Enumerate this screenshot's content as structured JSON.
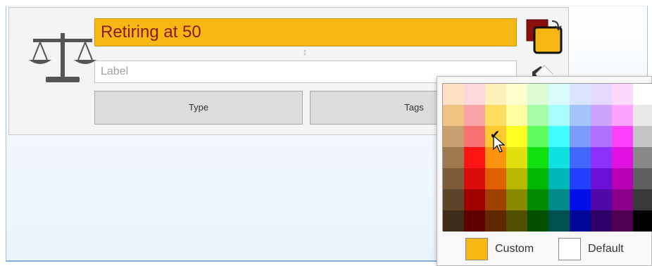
{
  "topic": {
    "title": "Retiring at 50",
    "label_placeholder": "Label",
    "icon": "balance-scale-icon",
    "buttons": {
      "type": "Type",
      "tags": "Tags"
    },
    "colors": {
      "background": "#f7b714",
      "text": "#8a1a10"
    }
  },
  "color_swap": {
    "icon": "swap-colors-icon",
    "foreground": "#8a1010",
    "background": "#f7b714"
  },
  "palette": {
    "rows": [
      [
        "#fde0c4",
        "#fcd8dc",
        "#fdf0b8",
        "#fefece",
        "#dcfcd4",
        "#d8fcfc",
        "#d8e4fc",
        "#e4d8fc",
        "#fcd8fc",
        "#ffffff"
      ],
      [
        "#f0c284",
        "#f9a4a8",
        "#fedc60",
        "#fefea0",
        "#a8fca8",
        "#a8fcfc",
        "#a4c4fc",
        "#cca4fc",
        "#fca4fc",
        "#e8e8e8"
      ],
      [
        "#c8a070",
        "#f87070",
        "#fec830",
        "#fefe20",
        "#60fc60",
        "#40fcfc",
        "#7c9cfc",
        "#b070fc",
        "#fc40fc",
        "#c4c4c4"
      ],
      [
        "#a07850",
        "#fc1414",
        "#fc9410",
        "#e0e010",
        "#10e010",
        "#10e0e0",
        "#4068fc",
        "#8c30fc",
        "#e010e0",
        "#888888"
      ],
      [
        "#7c5c38",
        "#d80c0c",
        "#e06000",
        "#b8b800",
        "#00b800",
        "#00b8b8",
        "#2040fc",
        "#6c10d8",
        "#b800b8",
        "#606060"
      ],
      [
        "#5c4428",
        "#a00000",
        "#a04000",
        "#8a8a00",
        "#008a00",
        "#008a8a",
        "#0010e8",
        "#5008a8",
        "#8a008a",
        "#383838"
      ],
      [
        "#3c2c18",
        "#600000",
        "#602800",
        "#505000",
        "#005000",
        "#005050",
        "#000898",
        "#300068",
        "#500050",
        "#000000"
      ]
    ],
    "selected": {
      "row": 2,
      "col": 2
    },
    "custom": {
      "label": "Custom",
      "color": "#f7b714"
    },
    "default": {
      "label": "Default",
      "color": "#ffffff"
    }
  }
}
